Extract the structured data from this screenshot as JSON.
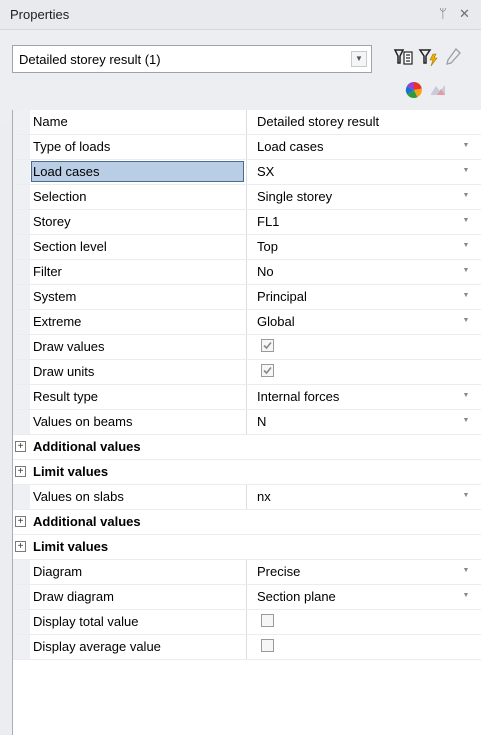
{
  "panel": {
    "title": "Properties",
    "pin_glyph": "ᛘ",
    "close_glyph": "✕"
  },
  "selector": {
    "value": "Detailed storey result (1)",
    "arrow_glyph": "▼",
    "icons": [
      "filter-all-icon",
      "filter-lightning-icon",
      "pencil-icon"
    ],
    "sub_icons": [
      "color-palette-icon",
      "display-settings-icon"
    ]
  },
  "properties": [
    {
      "type": "property",
      "name": "Name",
      "value": "Detailed storey result",
      "dropdown": false
    },
    {
      "type": "property",
      "name": "Type of loads",
      "value": "Load cases",
      "dropdown": true
    },
    {
      "type": "property",
      "name": "Load cases",
      "value": "SX",
      "dropdown": true,
      "selected": true
    },
    {
      "type": "property",
      "name": "Selection",
      "value": "Single storey",
      "dropdown": true
    },
    {
      "type": "property",
      "name": "Storey",
      "value": "FL1",
      "dropdown": true
    },
    {
      "type": "property",
      "name": "Section level",
      "value": "Top",
      "dropdown": true
    },
    {
      "type": "property",
      "name": "Filter",
      "value": "No",
      "dropdown": true
    },
    {
      "type": "property",
      "name": "System",
      "value": "Principal",
      "dropdown": true
    },
    {
      "type": "property",
      "name": "Extreme",
      "value": "Global",
      "dropdown": true
    },
    {
      "type": "checkbox",
      "name": "Draw values",
      "checked": true
    },
    {
      "type": "checkbox",
      "name": "Draw units",
      "checked": true
    },
    {
      "type": "property",
      "name": "Result type",
      "value": "Internal forces",
      "dropdown": true
    },
    {
      "type": "property",
      "name": "Values on beams",
      "value": "N",
      "dropdown": true
    },
    {
      "type": "section",
      "name": "Additional values",
      "expander": "+"
    },
    {
      "type": "section",
      "name": "Limit values",
      "expander": "+"
    },
    {
      "type": "property",
      "name": "Values on slabs",
      "value": "nx",
      "dropdown": true
    },
    {
      "type": "section",
      "name": "Additional values",
      "expander": "+"
    },
    {
      "type": "section",
      "name": "Limit values",
      "expander": "+"
    },
    {
      "type": "property",
      "name": "Diagram",
      "value": "Precise",
      "dropdown": true
    },
    {
      "type": "property",
      "name": "Draw diagram",
      "value": "Section plane",
      "dropdown": true
    },
    {
      "type": "checkbox",
      "name": "Display total value",
      "checked": false
    },
    {
      "type": "checkbox",
      "name": "Display average value",
      "checked": false
    }
  ],
  "dropdown_glyph": "▼",
  "colors": {
    "selection_fill": "#b9cde5",
    "selection_border": "#4a6a90",
    "panel_bg": "#ecedf0",
    "grid_bg": "#ffffff"
  }
}
